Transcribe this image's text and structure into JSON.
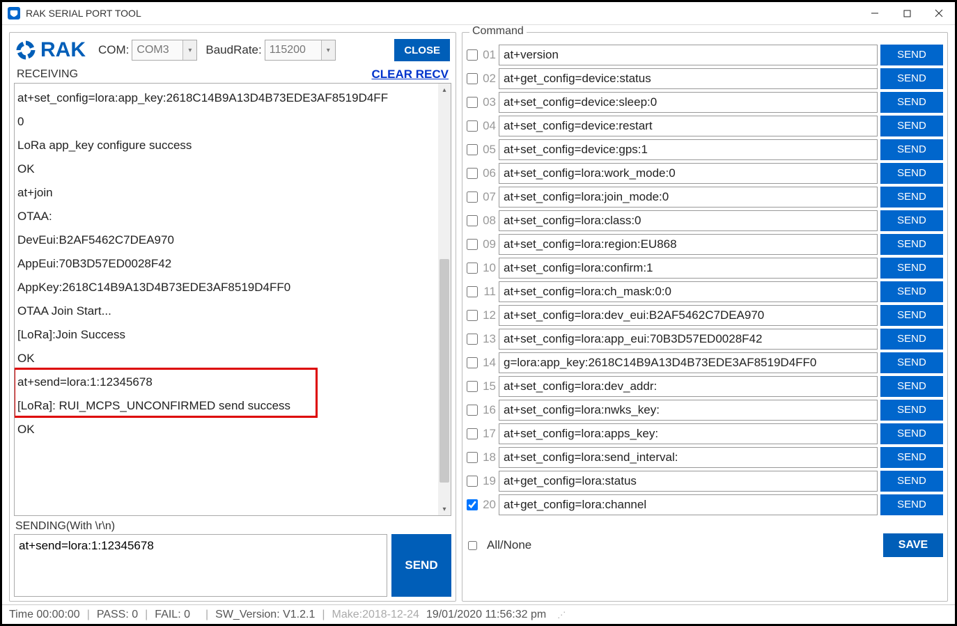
{
  "window": {
    "title": "RAK SERIAL PORT TOOL"
  },
  "logo": {
    "text": "RAK"
  },
  "conn": {
    "com_label": "COM:",
    "com_value": "COM3",
    "baud_label": "BaudRate:",
    "baud_value": "115200",
    "close_btn": "CLOSE"
  },
  "receiving": {
    "label": "RECEIVING",
    "clear_link": "CLEAR RECV",
    "lines": [
      "at+set_config=lora:app_key:2618C14B9A13D4B73EDE3AF8519D4FF",
      "0",
      "LoRa app_key configure success",
      "OK",
      "at+join",
      "OTAA:",
      "DevEui:B2AF5462C7DEA970",
      "AppEui:70B3D57ED0028F42",
      "AppKey:2618C14B9A13D4B73EDE3AF8519D4FF0",
      "OTAA Join Start...",
      "[LoRa]:Join Success",
      "OK",
      "at+send=lora:1:12345678",
      "[LoRa]: RUI_MCPS_UNCONFIRMED send success",
      "OK"
    ]
  },
  "sending": {
    "label": "SENDING(With \\r\\n)",
    "value": "at+send=lora:1:12345678",
    "send_btn": "SEND"
  },
  "command": {
    "legend": "Command",
    "send_label": "SEND",
    "all_none_label": "All/None",
    "save_btn": "SAVE",
    "rows": [
      {
        "num": "01",
        "checked": false,
        "cmd": "at+version"
      },
      {
        "num": "02",
        "checked": false,
        "cmd": "at+get_config=device:status"
      },
      {
        "num": "03",
        "checked": false,
        "cmd": "at+set_config=device:sleep:0"
      },
      {
        "num": "04",
        "checked": false,
        "cmd": "at+set_config=device:restart"
      },
      {
        "num": "05",
        "checked": false,
        "cmd": "at+set_config=device:gps:1"
      },
      {
        "num": "06",
        "checked": false,
        "cmd": "at+set_config=lora:work_mode:0"
      },
      {
        "num": "07",
        "checked": false,
        "cmd": "at+set_config=lora:join_mode:0"
      },
      {
        "num": "08",
        "checked": false,
        "cmd": "at+set_config=lora:class:0"
      },
      {
        "num": "09",
        "checked": false,
        "cmd": "at+set_config=lora:region:EU868"
      },
      {
        "num": "10",
        "checked": false,
        "cmd": "at+set_config=lora:confirm:1"
      },
      {
        "num": "11",
        "checked": false,
        "cmd": "at+set_config=lora:ch_mask:0:0"
      },
      {
        "num": "12",
        "checked": false,
        "cmd": "at+set_config=lora:dev_eui:B2AF5462C7DEA970"
      },
      {
        "num": "13",
        "checked": false,
        "cmd": "at+set_config=lora:app_eui:70B3D57ED0028F42"
      },
      {
        "num": "14",
        "checked": false,
        "cmd": "g=lora:app_key:2618C14B9A13D4B73EDE3AF8519D4FF0"
      },
      {
        "num": "15",
        "checked": false,
        "cmd": "at+set_config=lora:dev_addr:"
      },
      {
        "num": "16",
        "checked": false,
        "cmd": "at+set_config=lora:nwks_key:"
      },
      {
        "num": "17",
        "checked": false,
        "cmd": "at+set_config=lora:apps_key:"
      },
      {
        "num": "18",
        "checked": false,
        "cmd": "at+set_config=lora:send_interval:"
      },
      {
        "num": "19",
        "checked": false,
        "cmd": "at+get_config=lora:status"
      },
      {
        "num": "20",
        "checked": true,
        "cmd": "at+get_config=lora:channel"
      }
    ]
  },
  "status": {
    "time": "Time  00:00:00",
    "pass": "PASS:  0",
    "fail": "FAIL:  0",
    "version": "SW_Version:  V1.2.1",
    "make": "Make:2018-12-24",
    "clock": "19/01/2020 11:56:32 pm"
  }
}
